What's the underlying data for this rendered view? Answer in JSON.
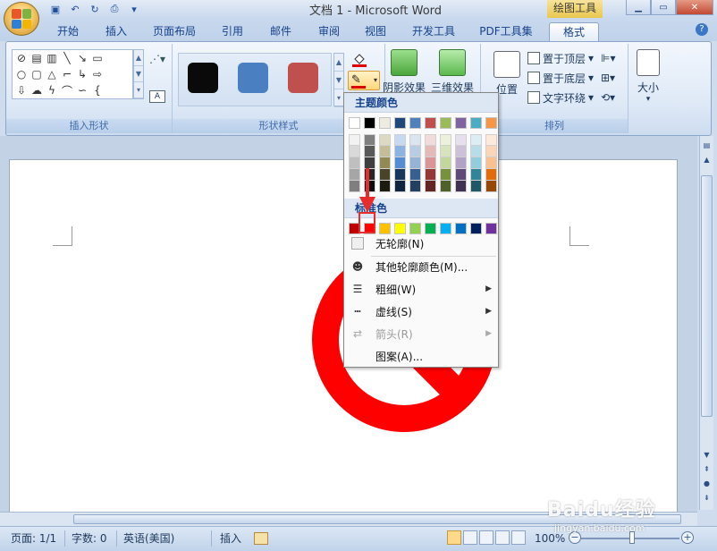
{
  "window": {
    "title": "文档 1 - Microsoft Word",
    "context_title": "绘图工具"
  },
  "tabs": [
    "开始",
    "插入",
    "页面布局",
    "引用",
    "邮件",
    "审阅",
    "视图",
    "开发工具",
    "PDF工具集",
    "格式"
  ],
  "active_tab": "格式",
  "ribbon": {
    "groups": {
      "insert_shapes": "插入形状",
      "shape_styles": "形状样式",
      "arrange": "排列"
    },
    "buttons": {
      "shadow_effects": "阴影效果",
      "3d_effects": "三维效果",
      "position": "位置",
      "bring_to_front": "置于顶层",
      "send_to_back": "置于底层",
      "text_wrapping": "文字环绕",
      "size": "大小"
    },
    "style_colors": [
      "#0a0a0a",
      "#4a7fc1",
      "#c0504d"
    ]
  },
  "outline_menu": {
    "theme_header": "主题颜色",
    "standard_header": "标准色",
    "theme_colors": [
      "#ffffff",
      "#000000",
      "#eeece1",
      "#1f497d",
      "#4f81bd",
      "#c0504d",
      "#9bbb59",
      "#8064a2",
      "#4bacc6",
      "#f79646"
    ],
    "theme_shades": [
      [
        "#f2f2f2",
        "#d9d9d9",
        "#bfbfbf",
        "#a6a6a6",
        "#7f7f7f"
      ],
      [
        "#7f7f7f",
        "#595959",
        "#3f3f3f",
        "#262626",
        "#0c0c0c"
      ],
      [
        "#ddd9c3",
        "#c4bd97",
        "#938953",
        "#494429",
        "#1d1b10"
      ],
      [
        "#c6d9f0",
        "#8db3e2",
        "#548dd4",
        "#17365d",
        "#0f243e"
      ],
      [
        "#dbe5f1",
        "#b8cce4",
        "#95b3d7",
        "#366092",
        "#244061"
      ],
      [
        "#f2dcdb",
        "#e5b9b7",
        "#d99694",
        "#953734",
        "#632423"
      ],
      [
        "#ebf1dd",
        "#d7e3bc",
        "#c3d69b",
        "#76923c",
        "#4f6128"
      ],
      [
        "#e5e0ec",
        "#ccc1d9",
        "#b2a2c7",
        "#5f497a",
        "#3f3151"
      ],
      [
        "#dbeef3",
        "#b7dde8",
        "#92cddc",
        "#31859b",
        "#205867"
      ],
      [
        "#fdeada",
        "#fbd5b5",
        "#fac08f",
        "#e36c09",
        "#974806"
      ]
    ],
    "standard_colors": [
      "#c00000",
      "#ff0000",
      "#ffc000",
      "#ffff00",
      "#92d050",
      "#00b050",
      "#00b0f0",
      "#0070c0",
      "#002060",
      "#7030a0"
    ],
    "items": {
      "no_outline": "无轮廓(N)",
      "more_colors": "其他轮廓颜色(M)...",
      "weight": "粗细(W)",
      "dashes": "虚线(S)",
      "arrows": "箭头(R)",
      "pattern": "图案(A)..."
    }
  },
  "document": {
    "shape_color": "#ff0000"
  },
  "statusbar": {
    "page": "页面: 1/1",
    "words": "字数: 0",
    "language": "英语(美国)",
    "insert_mode": "插入",
    "zoom": "100%"
  },
  "watermark": {
    "brand": "Baidu经验",
    "url": "jingyan.baidu.com"
  }
}
